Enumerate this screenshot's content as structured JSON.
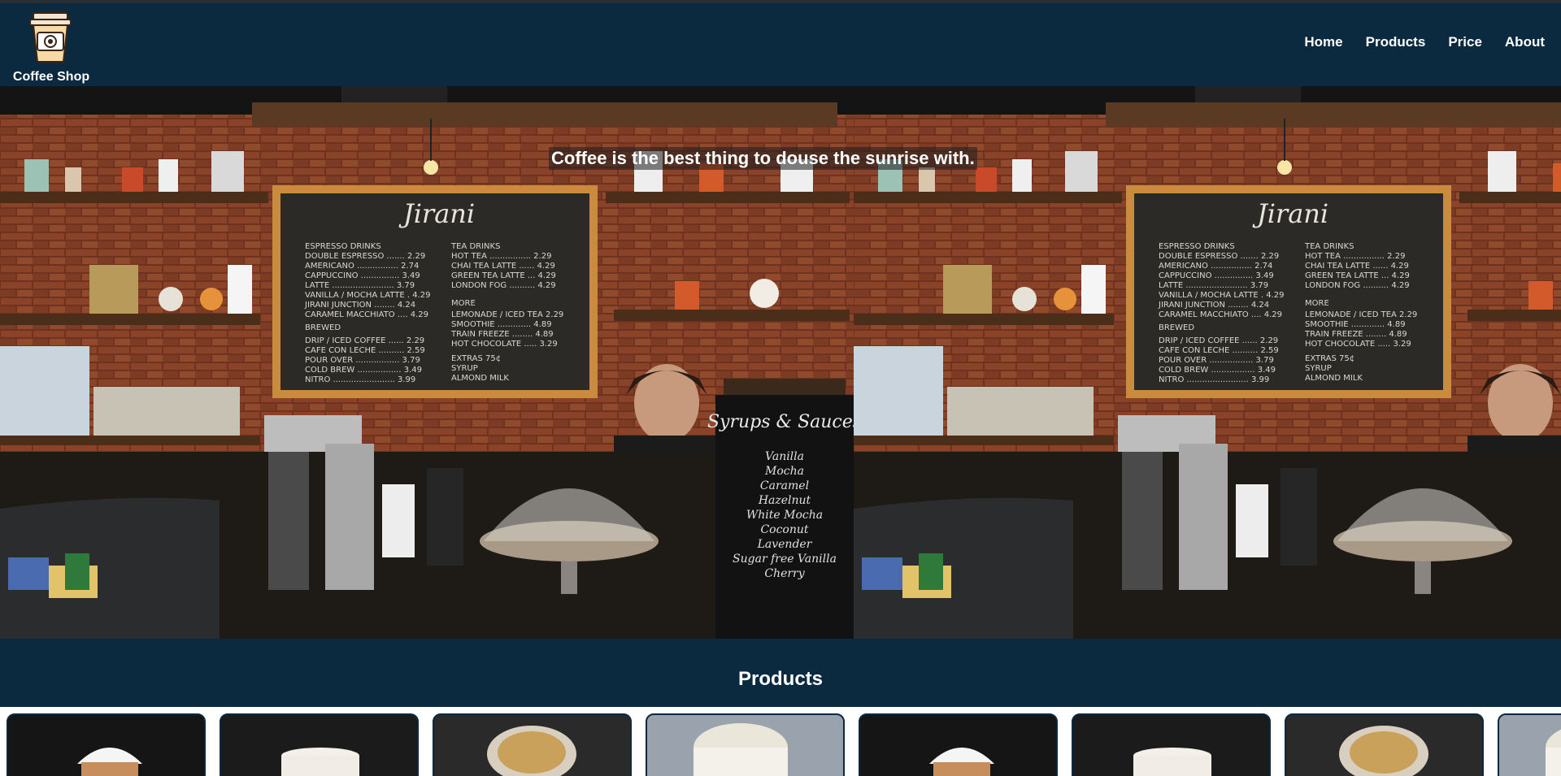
{
  "nav": {
    "brand": "Coffee Shop",
    "logo_icon": "coffee-cup-icon",
    "links": [
      "Home",
      "Products",
      "Price",
      "About"
    ]
  },
  "hero": {
    "tagline": "Coffee is the best thing to douse the sunrise with.",
    "image_description_icon": "coffee-bar-photo"
  },
  "products": {
    "title": "Products",
    "cards": [
      {
        "icon": "whipped-cream-drink-photo"
      },
      {
        "icon": "latte-cup-photo"
      },
      {
        "icon": "cappuccino-glass-photo"
      },
      {
        "icon": "foam-latte-photo"
      },
      {
        "icon": "whipped-cream-drink-photo"
      },
      {
        "icon": "latte-cup-photo"
      },
      {
        "icon": "cappuccino-glass-photo"
      },
      {
        "icon": "foam-latte-photo"
      }
    ]
  },
  "colors": {
    "nav_bg": "#0b2a40",
    "text": "#ffffff",
    "brick": "#7a3a22",
    "chalkboard": "#2b2a27"
  }
}
